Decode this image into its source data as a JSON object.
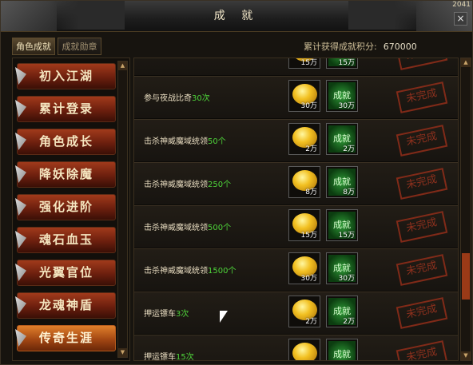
{
  "window": {
    "title": "成 就",
    "clock": "2041",
    "close": "×"
  },
  "tabs": [
    {
      "label": "角色成就"
    },
    {
      "label": "成就勋章"
    }
  ],
  "total": {
    "label": "累计获得成就积分:",
    "value": "670000"
  },
  "categories": [
    {
      "label": "初入江湖"
    },
    {
      "label": "累计登录"
    },
    {
      "label": "角色成长"
    },
    {
      "label": "降妖除魔"
    },
    {
      "label": "强化进阶"
    },
    {
      "label": "魂石血玉"
    },
    {
      "label": "光翼官位"
    },
    {
      "label": "龙魂神盾"
    },
    {
      "label": "传奇生涯"
    }
  ],
  "scroll_arrows": {
    "up": "▲",
    "down": "▼"
  },
  "achievements": [
    {
      "desc": "",
      "count": "",
      "coin": "15万",
      "badge_label": "成就",
      "badge": "15万",
      "status": "未完成"
    },
    {
      "desc": "参与夜战比奇",
      "count": "30次",
      "coin": "30万",
      "badge_label": "成就",
      "badge": "30万",
      "status": "未完成"
    },
    {
      "desc": "击杀神威魔域统领",
      "count": "50个",
      "coin": "2万",
      "badge_label": "成就",
      "badge": "2万",
      "status": "未完成"
    },
    {
      "desc": "击杀神威魔域统领",
      "count": "250个",
      "coin": "8万",
      "badge_label": "成就",
      "badge": "8万",
      "status": "未完成"
    },
    {
      "desc": "击杀神威魔域统领",
      "count": "500个",
      "coin": "15万",
      "badge_label": "成就",
      "badge": "15万",
      "status": "未完成"
    },
    {
      "desc": "击杀神威魔域统领",
      "count": "1500个",
      "coin": "30万",
      "badge_label": "成就",
      "badge": "30万",
      "status": "未完成"
    },
    {
      "desc": "押运镖车",
      "count": "3次",
      "coin": "2万",
      "badge_label": "成就",
      "badge": "2万",
      "status": "未完成"
    },
    {
      "desc": "押运镖车",
      "count": "15次",
      "coin": "",
      "badge_label": "成就",
      "badge": "",
      "status": "未完成"
    }
  ]
}
